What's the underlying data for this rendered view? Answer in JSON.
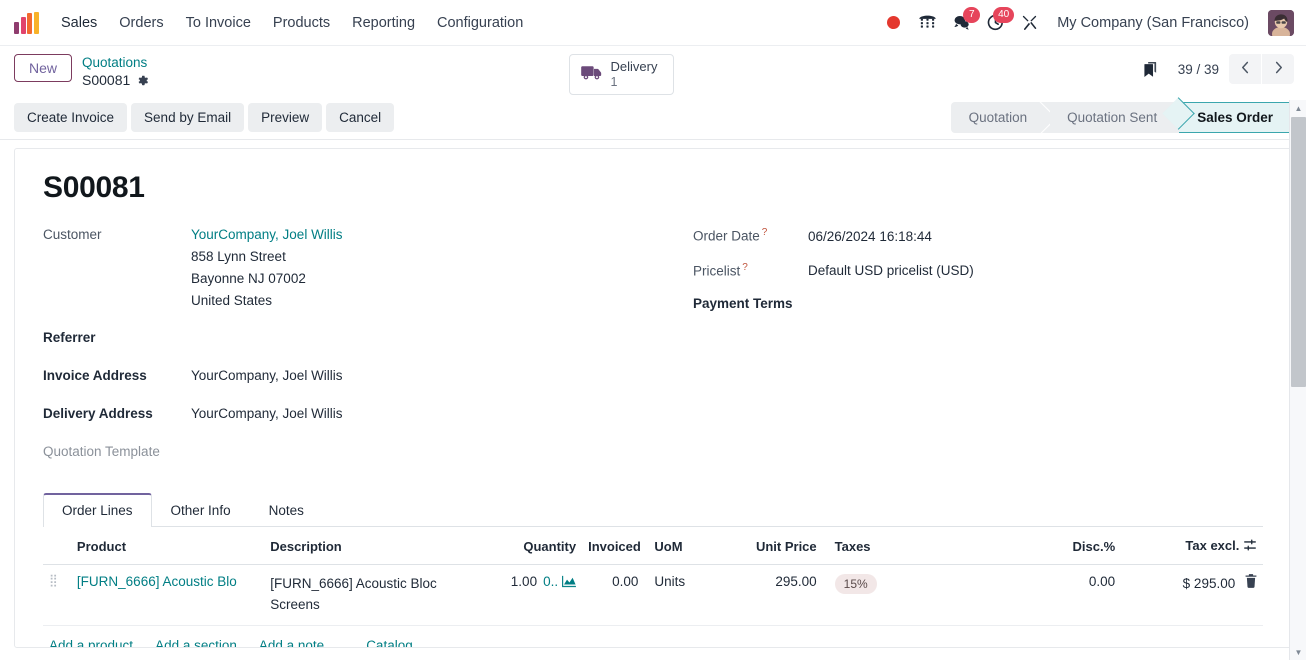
{
  "navbar": {
    "brand": "odoo-logo",
    "app_name": "Sales",
    "menu": [
      "Orders",
      "To Invoice",
      "Products",
      "Reporting",
      "Configuration"
    ],
    "systray": {
      "recording_icon": "record-dot-icon",
      "dialpad_icon": "phone-dialpad-icon",
      "messages_icon": "chat-bubble-icon",
      "messages_count": "7",
      "activities_icon": "clock-activity-icon",
      "activities_count": "40",
      "tools_icon": "wrench-tools-icon",
      "company": "My Company (San Francisco)",
      "avatar": "user-avatar"
    }
  },
  "controlpanel": {
    "new_label": "New",
    "breadcrumb_parent": "Quotations",
    "breadcrumb_current": "S00081",
    "gear_icon": "gear-icon",
    "smart_button": {
      "icon": "delivery-truck-icon",
      "label": "Delivery",
      "value": "1"
    },
    "bookmark_icon": "bookmark-icon",
    "pager": "39 / 39",
    "pager_prev_icon": "chevron-left-icon",
    "pager_next_icon": "chevron-right-icon",
    "actions": [
      "Create Invoice",
      "Send by Email",
      "Preview",
      "Cancel"
    ],
    "statusbar": {
      "stages": [
        "Quotation",
        "Quotation Sent",
        "Sales Order"
      ],
      "active": "Sales Order",
      "active_color": "#3aa6ad",
      "active_bg": "#e5f3f4"
    }
  },
  "record": {
    "title": "S00081",
    "left_fields": [
      {
        "label": "Customer",
        "value": "YourCompany, Joel Willis",
        "is_link": true,
        "bold": false
      },
      {
        "label": "Referrer",
        "value": "",
        "is_link": false,
        "bold": true
      },
      {
        "label": "Invoice Address",
        "value": "YourCompany, Joel Willis",
        "is_link": false,
        "bold": true
      },
      {
        "label": "Delivery Address",
        "value": "YourCompany, Joel Willis",
        "is_link": false,
        "bold": true
      },
      {
        "label": "Quotation Template",
        "value": "",
        "is_link": false,
        "bold": false
      }
    ],
    "customer_address": [
      "858 Lynn Street",
      "Bayonne NJ 07002",
      "United States"
    ],
    "right_fields": [
      {
        "label": "Order Date",
        "help": "?",
        "value": "06/26/2024 16:18:44",
        "bold": false
      },
      {
        "label": "Pricelist",
        "help": "?",
        "value": "Default USD pricelist (USD)",
        "bold": false
      },
      {
        "label": "Payment Terms",
        "help": "",
        "value": "",
        "bold": true
      }
    ]
  },
  "tabs": [
    {
      "label": "Order Lines",
      "active": true
    },
    {
      "label": "Other Info",
      "active": false
    },
    {
      "label": "Notes",
      "active": false
    }
  ],
  "order_lines": {
    "columns": [
      "Product",
      "Description",
      "Quantity",
      "Invoiced",
      "UoM",
      "Unit Price",
      "Taxes",
      "Disc.%",
      "Tax excl."
    ],
    "options_icon": "column-options-icon",
    "rows": [
      {
        "handle_icon": "drag-handle-icon",
        "product": "[FURN_6666] Acoustic Blo",
        "description": "[FURN_6666] Acoustic Bloc Screens",
        "quantity": "1.00",
        "quantity_extra": "0..",
        "forecast_icon": "forecast-chart-icon",
        "invoiced": "0.00",
        "uom": "Units",
        "unit_price": "295.00",
        "taxes": "15%",
        "discount": "0.00",
        "tax_excl": "$ 295.00",
        "delete_icon": "trash-icon"
      }
    ],
    "add_links": [
      "Add a product",
      "Add a section",
      "Add a note"
    ],
    "catalog_link": "Catalog"
  },
  "scrollbar": {
    "up_icon": "scroll-up-arrow-icon",
    "down_icon": "scroll-down-arrow-icon"
  }
}
